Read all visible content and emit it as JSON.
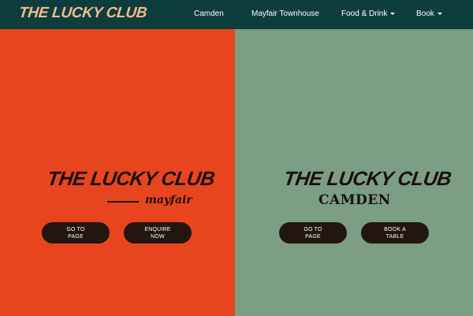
{
  "nav": {
    "brand": "THE LUCKY CLUB",
    "items": [
      {
        "label": "Camden",
        "dropdown": false
      },
      {
        "label": "Mayfair Townhouse",
        "dropdown": false
      },
      {
        "label": "Food & Drink",
        "dropdown": true
      },
      {
        "label": "Book",
        "dropdown": true
      }
    ]
  },
  "left_panel": {
    "logo": "THE LUCKY CLUB",
    "sub": "mayfair",
    "buttons": [
      {
        "line1": "GO TO",
        "line2": "PAGE"
      },
      {
        "line1": "ENQUIRE",
        "line2": "NOW"
      }
    ]
  },
  "right_panel": {
    "logo": "THE LUCKY CLUB",
    "sub": "CAMDEN",
    "buttons": [
      {
        "line1": "GO TO",
        "line2": "PAGE"
      },
      {
        "line1": "BOOK A",
        "line2": "TABLE"
      }
    ]
  },
  "colors": {
    "nav_bg": "#0d3d3c",
    "brand": "#f4b98f",
    "left_bg": "#e8451f",
    "right_bg": "#7b9e84",
    "button_bg": "#23150f"
  }
}
